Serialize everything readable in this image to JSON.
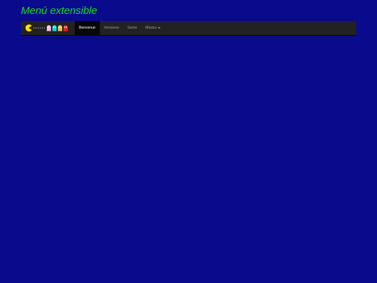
{
  "page": {
    "title": "Menú extensible"
  },
  "navbar": {
    "brand_icon": "pacman-ghosts-logo",
    "items": [
      {
        "label": "Bienvenue",
        "active": true
      },
      {
        "label": "Versiones",
        "active": false
      },
      {
        "label": "Gente",
        "active": false
      },
      {
        "label": "Música",
        "active": false,
        "dropdown": true
      }
    ]
  },
  "colors": {
    "background": "#0a0a8c",
    "title": "#1fd61f",
    "navbar": "#222222",
    "nav_active": "#080808",
    "nav_text": "#9d9d9d"
  }
}
